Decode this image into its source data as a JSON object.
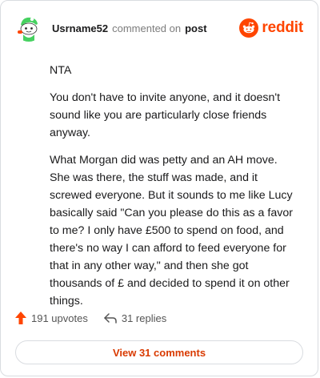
{
  "header": {
    "username": "Usrname52",
    "action_text": "commented on",
    "post_link": "post",
    "brand": "reddit"
  },
  "comment": {
    "paragraphs": [
      "NTA",
      "You don't have to invite anyone, and it doesn't sound like you are particularly close friends anyway.",
      "What Morgan did was petty and an AH move. She was there, the stuff was made, and it screwed everyone. But it sounds to me like Lucy basically said \"Can you please do this as a favor to me? I only have £500 to spend on food, and there's no way I can afford to feed everyone for that in any other way,\" and then she got thousands of £ and decided to spend it on other things."
    ]
  },
  "footer": {
    "upvotes": "191 upvotes",
    "replies": "31 replies",
    "view_button": "View 31 comments"
  },
  "colors": {
    "accent": "#ff4500",
    "button_text": "#d93a00",
    "avatar_green": "#46d160"
  },
  "icons": {
    "avatar": "snoo-avatar-icon",
    "brand": "reddit-logo-icon",
    "upvote": "upvote-arrow-icon",
    "reply": "reply-arrow-icon"
  }
}
